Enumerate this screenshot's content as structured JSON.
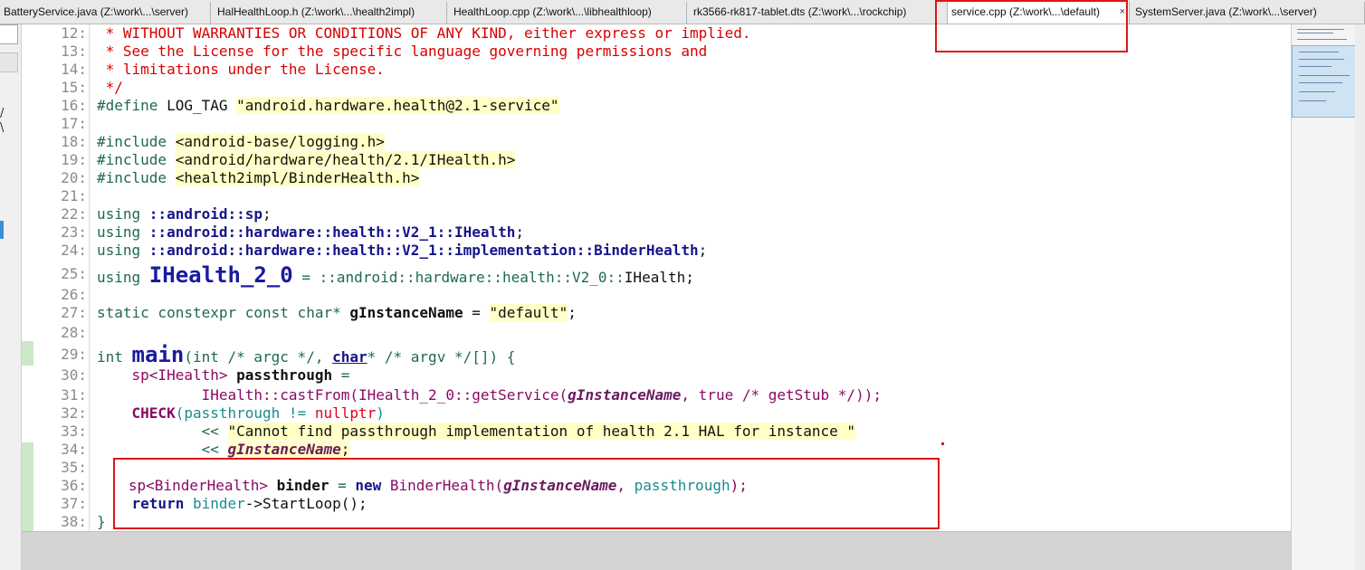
{
  "tabs": [
    {
      "label": "BatteryService.java (Z:\\work\\...\\server)",
      "active": false
    },
    {
      "label": "HalHealthLoop.h (Z:\\work\\...\\health2impl)",
      "active": false
    },
    {
      "label": "HealthLoop.cpp (Z:\\work\\...\\libhealthloop)",
      "active": false
    },
    {
      "label": "rk3566-rk817-tablet.dts (Z:\\work\\...\\rockchip)",
      "active": false
    },
    {
      "label": "service.cpp (Z:\\work\\...\\default)",
      "active": true,
      "close": "×"
    },
    {
      "label": "SystemServer.java (Z:\\work\\...\\server)",
      "active": false
    }
  ],
  "left_glyphs": "/\n\\",
  "line_numbers": [
    "12:",
    "13:",
    "14:",
    "15:",
    "16:",
    "17:",
    "18:",
    "19:",
    "20:",
    "21:",
    "22:",
    "23:",
    "24:",
    "25:",
    "26:",
    "27:",
    "28:",
    "29:",
    "30:",
    "31:",
    "32:",
    "33:",
    "34:",
    "35:",
    "36:",
    "37:",
    "38:"
  ],
  "code": {
    "l12": " * WITHOUT WARRANTIES OR CONDITIONS OF ANY KIND, either express or implied.",
    "l13": " * See the License for the specific language governing permissions and",
    "l14": " * limitations under the License.",
    "l15": " */",
    "l16_a": "#define ",
    "l16_b": "LOG_TAG",
    "l16_c": " ",
    "l16_d": "\"android.hardware.health@2.1-service\"",
    "l18_a": "#include ",
    "l18_b": "<android-base/logging.h>",
    "l19_a": "#include ",
    "l19_b": "<android/hardware/health/2.1/IHealth.h>",
    "l20_a": "#include ",
    "l20_b": "<health2impl/BinderHealth.h>",
    "l22_a": "using ",
    "l22_b": "::android::sp",
    "l22_c": ";",
    "l23_a": "using ",
    "l23_b": "::android::hardware::health::V2_1::IHealth",
    "l23_c": ";",
    "l24_a": "using ",
    "l24_b": "::android::hardware::health::V2_1::implementation::BinderHealth",
    "l24_c": ";",
    "l25_a": "using ",
    "l25_b": "IHealth_2_0",
    "l25_c": " = ::android::hardware::health::V2_0::",
    "l25_d": "IHealth;",
    "l27_a": "static constexpr const char* ",
    "l27_b": "gInstanceName",
    "l27_c": " = ",
    "l27_d": "\"default\"",
    "l27_e": ";",
    "l29_a": "int ",
    "l29_b": "main",
    "l29_c": "(int /* argc */, ",
    "l29_d": "char",
    "l29_e": "* /* argv */[]) {",
    "l30_a": "    sp<IHealth> ",
    "l30_b": "passthrough",
    "l30_c": " =",
    "l31_a": "            IHealth::castFrom(IHealth_2_0::getService(",
    "l31_b": "gInstanceName",
    "l31_c": ", true /* getStub */));",
    "l32_a": "    ",
    "l32_b": "CHECK",
    "l32_c": "(passthrough != ",
    "l32_d": "nullptr",
    "l32_e": ")",
    "l33_a": "            << ",
    "l33_b": "\"Cannot find passthrough implementation of health 2.1 HAL for instance \"",
    "l34_a": "            << ",
    "l34_b": "gInstanceName",
    "l34_c": ";",
    "l36_a": "   sp<BinderHealth> ",
    "l36_b": "binder",
    "l36_c": " = ",
    "l36_d": "new",
    "l36_e": " BinderHealth(",
    "l36_f": "gInstanceName",
    "l36_g": ", ",
    "l36_h": "passthrough",
    "l36_i": ");",
    "l37_a": "    return ",
    "l37_b": "binder",
    "l37_c": "->StartLoop();",
    "l38": "}"
  },
  "colors": {
    "comment": "#d80000",
    "preprocessor": "#1f6a4d",
    "string_bg": "#ffffc6",
    "annotation": "#e01414",
    "change_bar": "#cde8c8"
  }
}
